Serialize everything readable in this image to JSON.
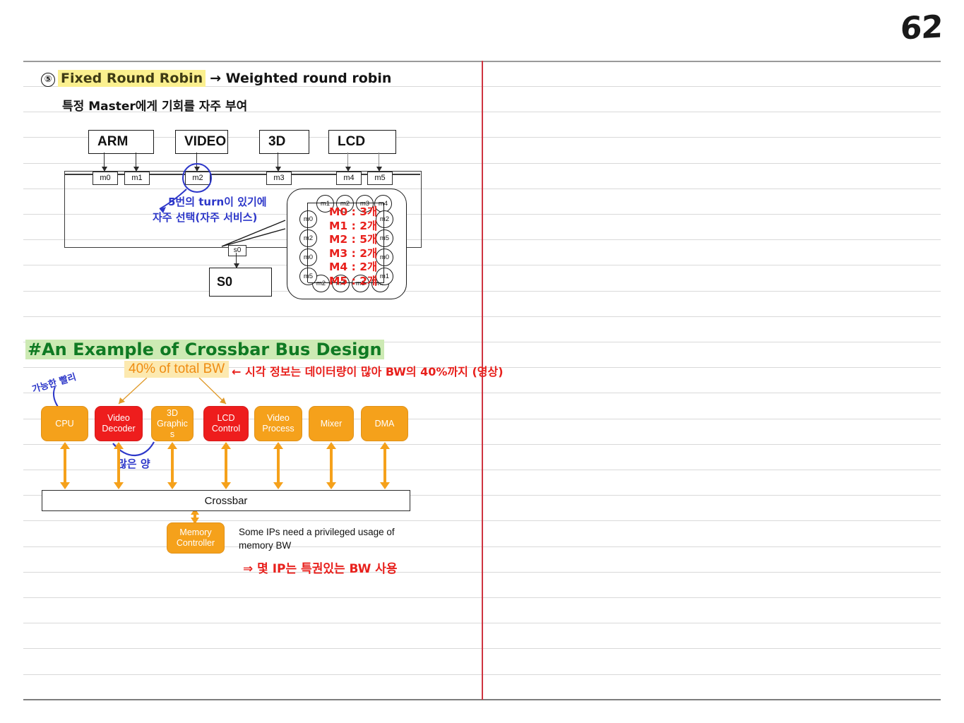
{
  "page": {
    "number": "62"
  },
  "section1": {
    "bullet": "⑤",
    "title_highlight": "Fixed Round Robin",
    "title_rest": "→ Weighted round robin",
    "subtitle": "특정 Master에게 기회를 자주 부여",
    "masters": [
      {
        "label": "ARM",
        "ports": [
          "m0",
          "m1"
        ]
      },
      {
        "label": "VIDEO",
        "ports": [
          "m2"
        ]
      },
      {
        "label": "3D",
        "ports": [
          "m3"
        ]
      },
      {
        "label": "LCD",
        "ports": [
          "m4",
          "m5"
        ]
      }
    ],
    "slave_port": "s0",
    "slave_box": "S0",
    "blue_annotation_line1": "5번의 turn이 있기에",
    "blue_annotation_line2": "자주 선택(자주 서비스)",
    "arbitration_ring": {
      "top": [
        "m1",
        "m2",
        "m3",
        "m4"
      ],
      "right": [
        "m2",
        "m5",
        "m0",
        "m1"
      ],
      "bottom": [
        "m2",
        "m4",
        "m3",
        "m2"
      ],
      "left": [
        "m0",
        "m2",
        "m0",
        "m5"
      ]
    },
    "counts": [
      "M0 : 3개",
      "M1 : 2개",
      "M2 : 5개",
      "M3 : 2개",
      "M4 : 2개",
      "M5 : 2개"
    ]
  },
  "section2": {
    "title": "#An Example of Crossbar Bus Design",
    "bw_label": "40% of total BW",
    "bw_note": "← 시각 정보는 데이터량이 많아 BW의 40%까지 (영상)",
    "ip_blocks": [
      {
        "label": "CPU",
        "color": "orange"
      },
      {
        "label": "Video\nDecoder",
        "color": "red"
      },
      {
        "label": "3D\nGraphic\ns",
        "color": "orange"
      },
      {
        "label": "LCD\nControl",
        "color": "red"
      },
      {
        "label": "Video\nProcess",
        "color": "orange"
      },
      {
        "label": "Mixer",
        "color": "orange"
      },
      {
        "label": "DMA",
        "color": "orange"
      }
    ],
    "crossbar_label": "Crossbar",
    "memory_controller": "Memory\nController",
    "memory_note": "Some IPs need a privileged usage of memory BW",
    "red_note": "⇒ 몇 IP는 특권있는 BW 사용",
    "cpu_note": "가능한 빨리",
    "many_note": "많은 양"
  },
  "colors": {
    "orange": "#F5A11B",
    "red": "#EE1D1D",
    "margin_red": "#CF3440",
    "green_title": "#0F7A23",
    "green_highlight": "#CDEAB4",
    "yellow_highlight": "#FBF08F",
    "blue_ink": "#2D37C9",
    "red_ink": "#E8201C"
  }
}
